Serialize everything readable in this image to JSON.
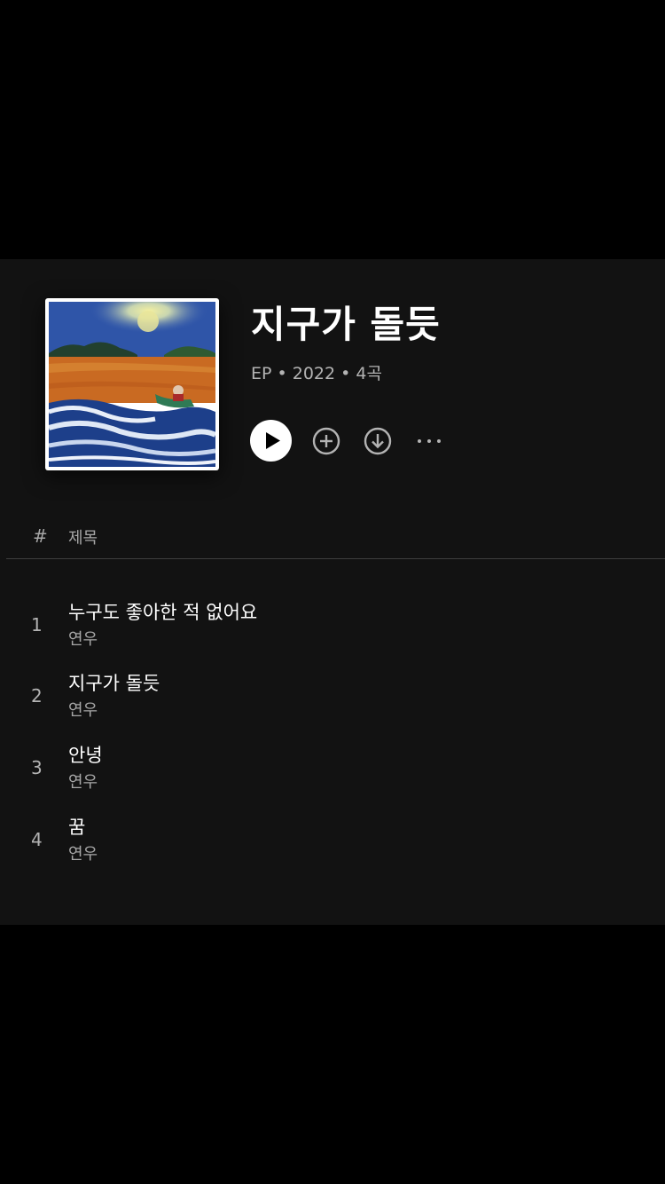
{
  "album": {
    "title": "지구가 돌듯",
    "meta": "EP • 2022 • 4곡"
  },
  "controls": {
    "play_icon": "play-icon",
    "add_icon": "plus-circle-icon",
    "download_icon": "download-circle-icon",
    "more_icon": "more-horizontal-icon"
  },
  "tracklist_header": {
    "number": "#",
    "title": "제목"
  },
  "tracks": [
    {
      "number": "1",
      "name": "누구도 좋아한 적 없어요",
      "artist": "연우"
    },
    {
      "number": "2",
      "name": "지구가 돌듯",
      "artist": "연우"
    },
    {
      "number": "3",
      "name": "안녕",
      "artist": "연우"
    },
    {
      "number": "4",
      "name": "꿈",
      "artist": "연우"
    }
  ],
  "colors": {
    "background": "#000000",
    "panel": "#121212",
    "text_primary": "#ffffff",
    "text_secondary": "#a7a7a7"
  }
}
